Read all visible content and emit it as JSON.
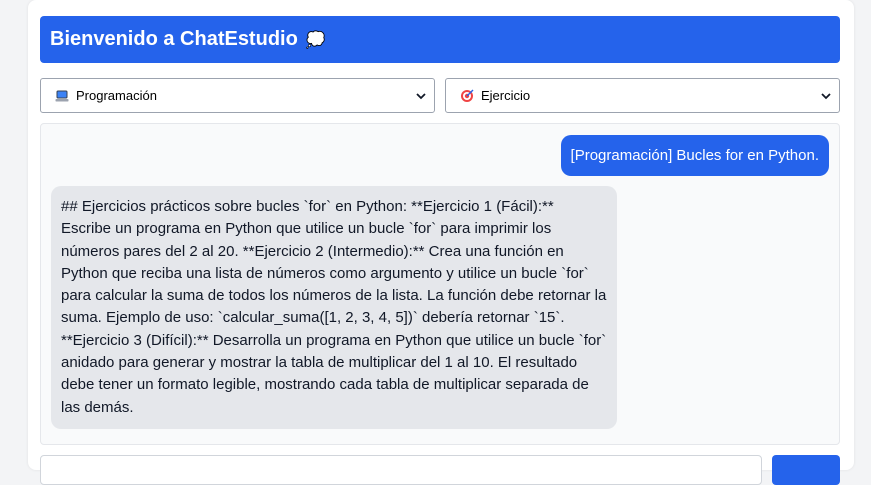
{
  "app": {
    "title": "Bienvenido a ChatEstudio",
    "title_emoji": "💭"
  },
  "controls": {
    "subject_select": {
      "icon": "laptop-icon",
      "selected": "Programación"
    },
    "mode_select": {
      "icon": "target-icon",
      "selected": "Ejercicio"
    }
  },
  "chat": {
    "messages": [
      {
        "role": "user",
        "text": "[Programación] Bucles for en Python."
      },
      {
        "role": "assistant",
        "text": "## Ejercicios prácticos sobre bucles `for` en Python: **Ejercicio 1 (Fácil):** Escribe un programa en Python que utilice un bucle `for` para imprimir los números pares del 2 al 20. **Ejercicio 2 (Intermedio):** Crea una función en Python que reciba una lista de números como argumento y utilice un bucle `for` para calcular la suma de todos los números de la lista. La función debe retornar la suma. Ejemplo de uso: `calcular_suma([1, 2, 3, 4, 5])` debería retornar `15`. **Ejercicio 3 (Difícil):** Desarrolla un programa en Python que utilice un bucle `for` anidado para generar y mostrar la tabla de multiplicar del 1 al 10. El resultado debe tener un formato legible, mostrando cada tabla de multiplicar separada de las demás."
      }
    ]
  },
  "colors": {
    "accent": "#2563eb",
    "bot_bubble": "#e5e7eb",
    "page_bg": "#f3f4f6"
  }
}
